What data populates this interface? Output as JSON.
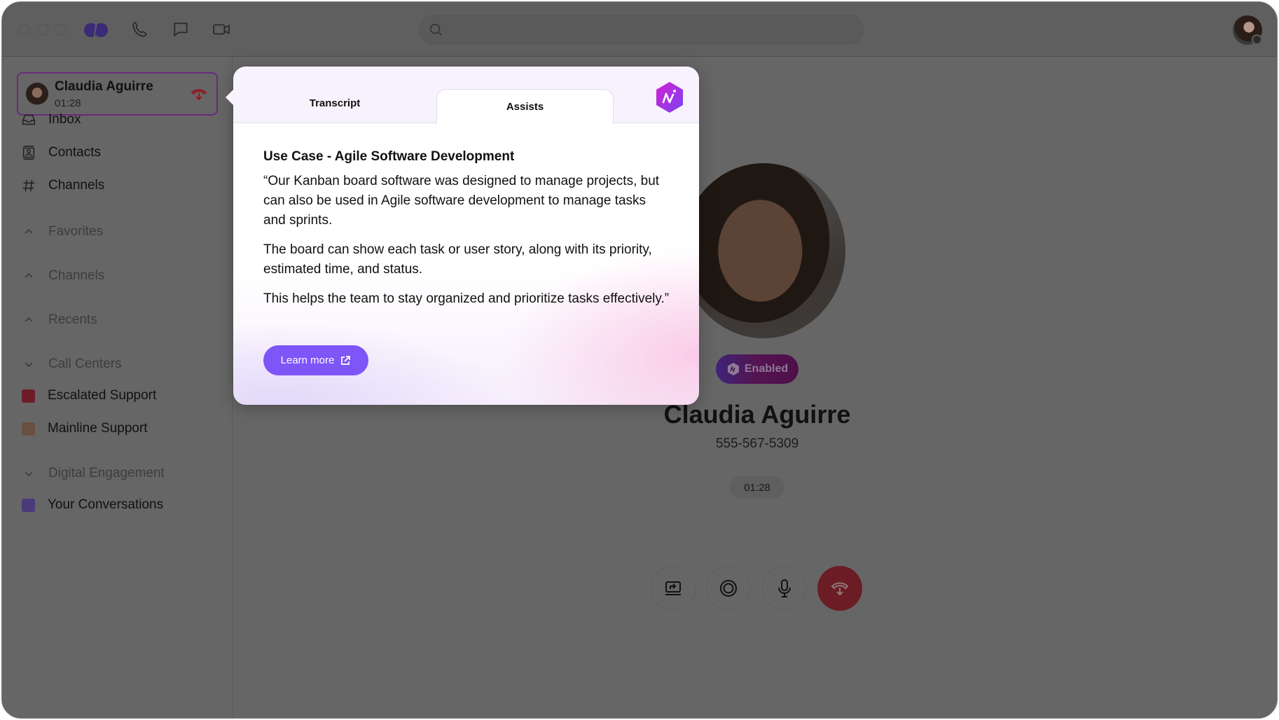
{
  "topbar": {
    "window_controls": [
      "close",
      "minimize",
      "maximize"
    ],
    "nav_icons": [
      "app-logo-icon",
      "phone-icon",
      "chat-icon",
      "video-icon"
    ],
    "search": {
      "placeholder": "",
      "value": ""
    },
    "user_status": "offline"
  },
  "active_call": {
    "name": "Claudia Aguirre",
    "duration": "01:28"
  },
  "sidebar": {
    "nav": [
      {
        "label": "Inbox",
        "icon": "inbox-icon"
      },
      {
        "label": "Contacts",
        "icon": "contacts-icon"
      },
      {
        "label": "Channels",
        "icon": "hash-icon"
      }
    ],
    "sections": [
      {
        "label": "Favorites",
        "expanded": false
      },
      {
        "label": "Channels",
        "expanded": false
      },
      {
        "label": "Recents",
        "expanded": false
      },
      {
        "label": "Call Centers",
        "expanded": true
      },
      {
        "label": "Digital Engagement",
        "expanded": true
      }
    ],
    "call_centers": [
      {
        "label": "Escalated Support",
        "color": "#6e1c2a"
      },
      {
        "label": "Mainline Support",
        "color": "#6a5042"
      }
    ],
    "digital_engagement": [
      {
        "label": "Your Conversations",
        "color": "#4a3a7a"
      }
    ]
  },
  "popup": {
    "tabs": [
      {
        "label": "Transcript",
        "active": false
      },
      {
        "label": "Assists",
        "active": true
      }
    ],
    "heading": "Use Case - Agile Software Development",
    "paragraphs": [
      "“Our Kanban board software was designed to manage projects, but can also be used in Agile software development to manage tasks and sprints.",
      "The board can show each task or user story, along with its priority, estimated time, and status.",
      "This helps the team to stay organized and prioritize tasks effectively.”"
    ],
    "learn_more_label": "Learn more",
    "accent_color": "#7e55f7"
  },
  "call_screen": {
    "ai_badge_label": "Enabled",
    "contact_name": "Claudia Aguirre",
    "phone_number": "555-567-5309",
    "timer": "01:28",
    "controls": [
      {
        "name": "share-screen",
        "icon": "share-screen-icon"
      },
      {
        "name": "record",
        "icon": "record-icon"
      },
      {
        "name": "mute",
        "icon": "microphone-icon"
      },
      {
        "name": "end-call",
        "icon": "hang-up-icon",
        "color": "#6b1c24"
      }
    ]
  }
}
